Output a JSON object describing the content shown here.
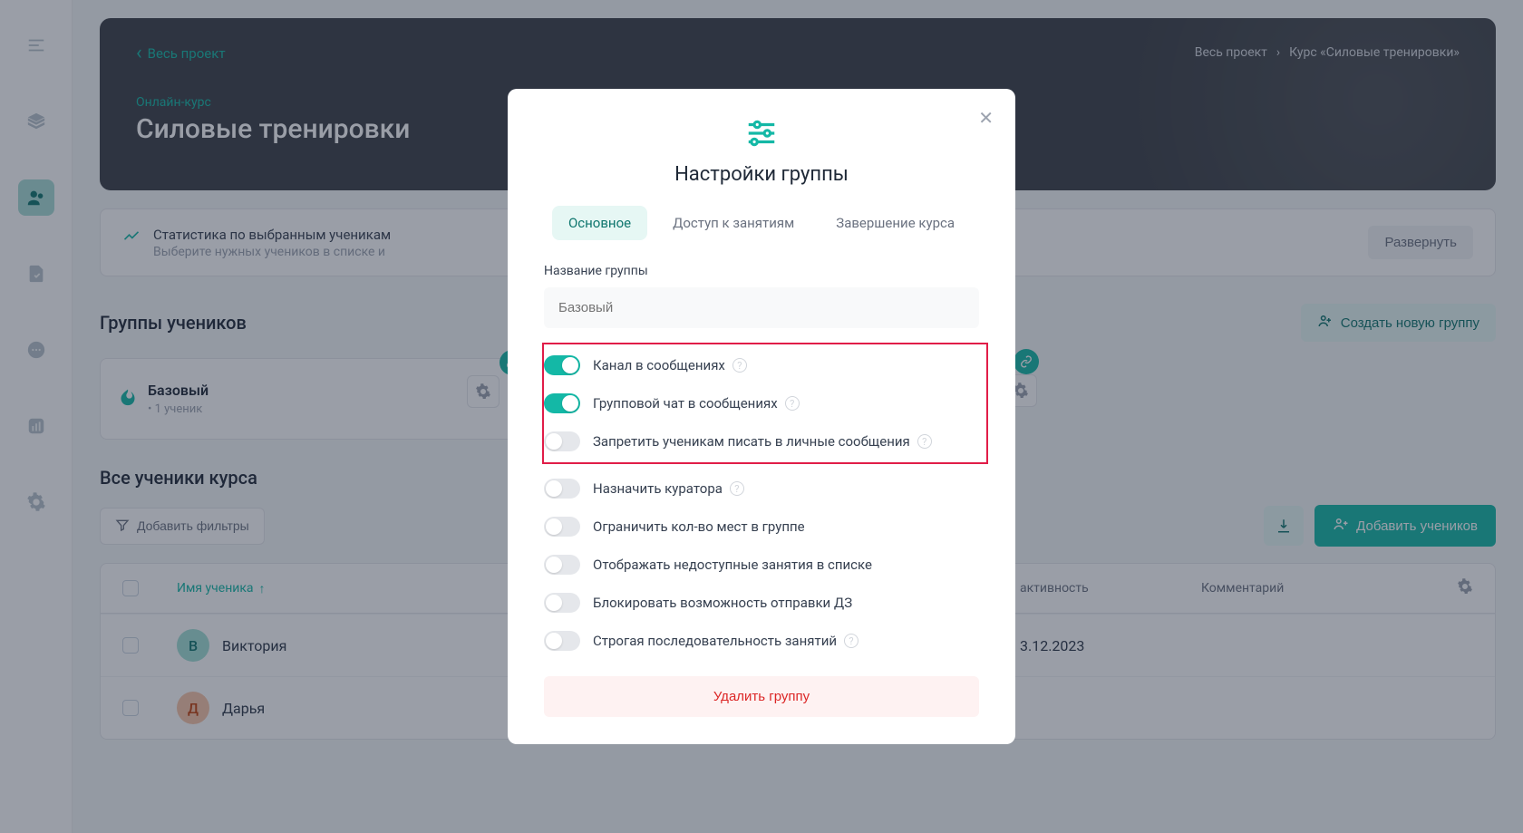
{
  "banner": {
    "back": "Весь проект",
    "subtitle": "Онлайн-курс",
    "title": "Силовые тренировки",
    "breadcrumb1": "Весь проект",
    "breadcrumb2": "Курс «Силовые тренировки»"
  },
  "stats": {
    "title": "Статистика по выбранным ученикам",
    "subtitle": "Выберите нужных учеников в списке и",
    "expand": "Развернуть"
  },
  "groups": {
    "heading": "Группы учеников",
    "create": "Создать новую группу",
    "cards": [
      {
        "name": "Базовый",
        "count": "1 ученик"
      }
    ]
  },
  "students": {
    "heading": "Все ученики курса",
    "filter": "Добавить фильтры",
    "add": "Добавить учеников",
    "columns": {
      "name": "Имя ученика",
      "activity": "активность",
      "comment": "Комментарий"
    },
    "rows": [
      {
        "initial": "В",
        "name": "Виктория",
        "date": "3.12.2023"
      },
      {
        "initial": "Д",
        "name": "Дарья",
        "date": ""
      }
    ]
  },
  "modal": {
    "title": "Настройки группы",
    "tabs": [
      "Основное",
      "Доступ к занятиям",
      "Завершение курса"
    ],
    "field_label": "Название группы",
    "field_placeholder": "Базовый",
    "toggles": [
      {
        "label": "Канал в сообщениях",
        "on": true,
        "help": true,
        "highlighted": true
      },
      {
        "label": "Групповой чат в сообщениях",
        "on": true,
        "help": true,
        "highlighted": true
      },
      {
        "label": "Запретить ученикам писать в личные сообщения",
        "on": false,
        "help": true,
        "highlighted": true
      },
      {
        "label": "Назначить куратора",
        "on": false,
        "help": true,
        "highlighted": false
      },
      {
        "label": "Ограничить кол-во мест в группе",
        "on": false,
        "help": false,
        "highlighted": false
      },
      {
        "label": "Отображать недоступные занятия в списке",
        "on": false,
        "help": false,
        "highlighted": false
      },
      {
        "label": "Блокировать возможность отправки ДЗ",
        "on": false,
        "help": false,
        "highlighted": false
      },
      {
        "label": "Строгая последовательность занятий",
        "on": false,
        "help": true,
        "highlighted": false
      }
    ],
    "delete": "Удалить группу"
  }
}
